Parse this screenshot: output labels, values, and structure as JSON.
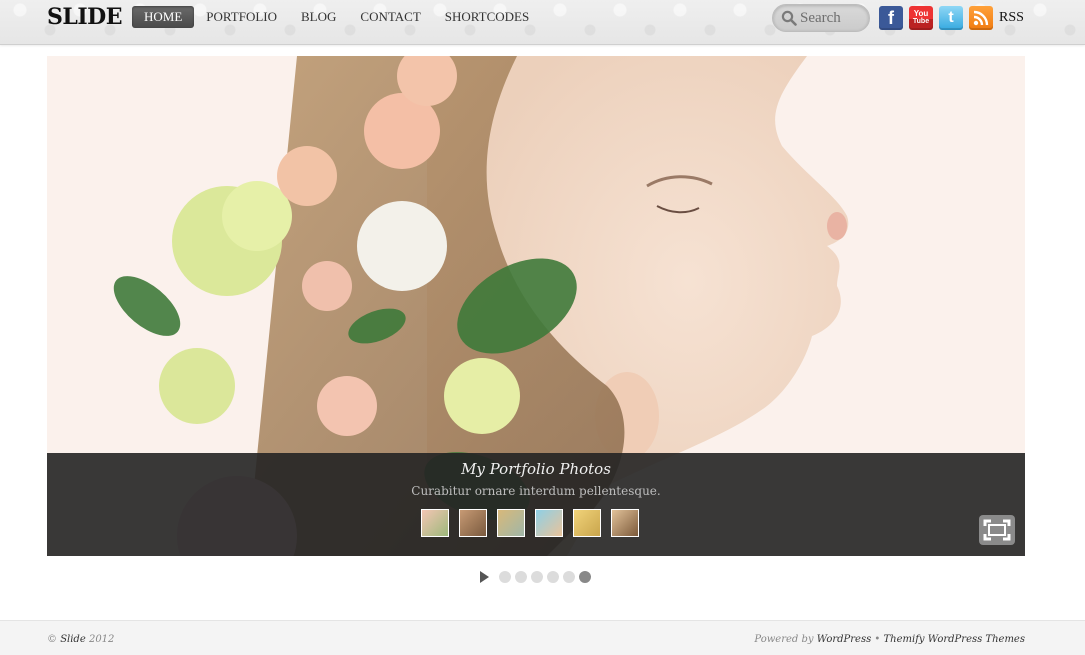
{
  "header": {
    "logo": "SLIDE",
    "nav": [
      {
        "label": "HOME",
        "active": true
      },
      {
        "label": "PORTFOLIO",
        "active": false
      },
      {
        "label": "BLOG",
        "active": false
      },
      {
        "label": "CONTACT",
        "active": false
      },
      {
        "label": "SHORTCODES",
        "active": false
      }
    ],
    "search": {
      "placeholder": "Search"
    },
    "social": {
      "facebook": "facebook-icon",
      "youtube": "youtube-icon",
      "youtube_top": "You",
      "youtube_bottom": "Tube",
      "twitter": "twitter-icon",
      "rss": "rss-icon",
      "rss_label": "RSS"
    }
  },
  "slider": {
    "caption_title": "My Portfolio Photos",
    "caption_text": "Curabitur ornare interdum pellentesque.",
    "thumb_count": 6,
    "slide_count": 6,
    "active_slide": 6
  },
  "footer": {
    "copyright_symbol": "©",
    "site_name": "Slide",
    "year": "2012",
    "powered_by": "Powered by",
    "wordpress": "WordPress",
    "separator": "•",
    "themify": "Themify WordPress Themes"
  },
  "colors": {
    "nav_active_bg": "#4a4a4a",
    "caption_bg": "#232323",
    "pager_active": "#888888"
  }
}
